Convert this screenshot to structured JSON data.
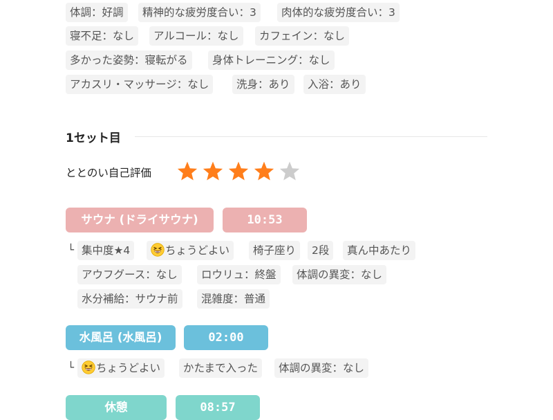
{
  "conditions": [
    [
      "体調：好調",
      "精神的な疲労度合い：3",
      "肉体的な疲労度合い：3"
    ],
    [
      "寝不足：なし",
      "アルコール：なし",
      "カフェイン：なし"
    ],
    [
      "多かった姿勢：寝転がる",
      "身体トレーニング：なし"
    ],
    [
      "アカスリ・マッサージ：なし",
      "洗身：あり",
      "入浴：あり"
    ]
  ],
  "set": {
    "title": "1セット目",
    "rating_label": "ととのい自己評価",
    "rating": 4,
    "rating_max": 5,
    "colors": {
      "star_on": "#ff7e1b",
      "star_off": "#cccccc"
    }
  },
  "sauna": {
    "label": "サウナ (ドライサウナ)",
    "time": "10:53",
    "color": "#ecb1b1",
    "branch": "└",
    "tags": [
      [
        "集中度★4",
        "ちょうどよい",
        "椅子座り",
        "2段",
        "真ん中あたり"
      ],
      [
        "アウフグース：なし",
        "ロウリュ：終盤",
        "体調の異変：なし"
      ],
      [
        "水分補給：サウナ前",
        "混雑度：普通"
      ]
    ],
    "emoji_icon": "grinning-squinting-face-icon"
  },
  "cold_bath": {
    "label": "水風呂 (水風呂)",
    "time": "02:00",
    "color": "#6bc0dc",
    "branch": "└",
    "tags": [
      [
        "ちょうどよい",
        "かたまで入った",
        "体調の異変：なし"
      ]
    ],
    "emoji_icon": "grinning-squinting-face-icon"
  },
  "rest": {
    "label": "休憩",
    "time": "08:57",
    "color": "#7fd6cc"
  }
}
